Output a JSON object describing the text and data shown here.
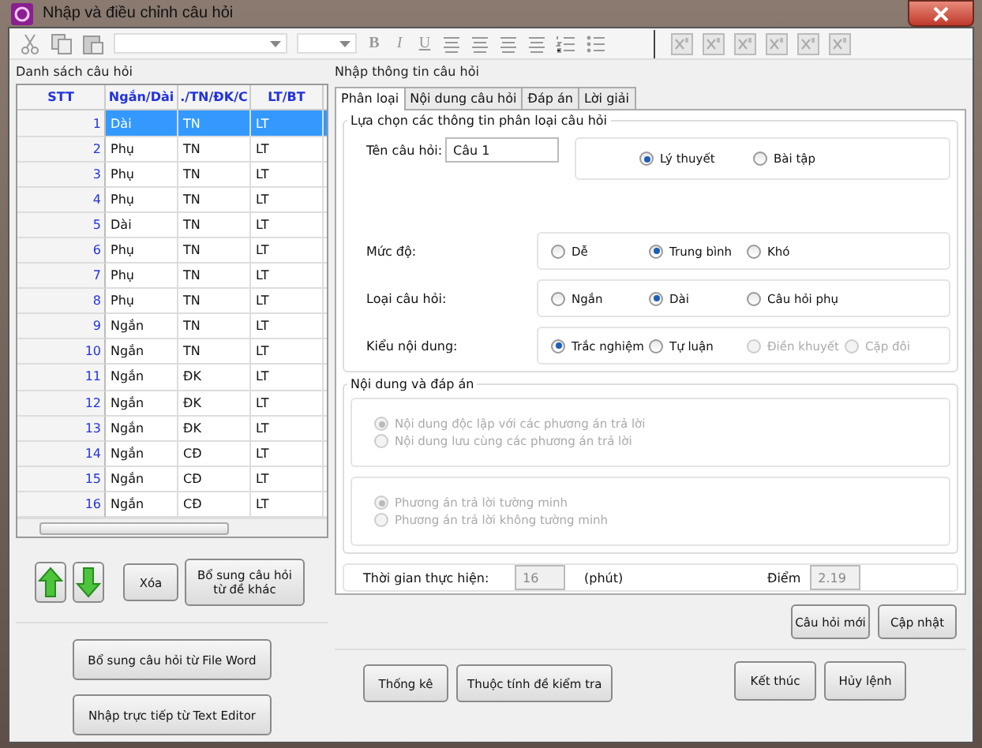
{
  "window": {
    "title": "Nhập và điều chỉnh câu hỏi"
  },
  "toolbar": {
    "format_buttons": [
      "B",
      "I",
      "U"
    ]
  },
  "question_list": {
    "title": "Danh sách câu hỏi",
    "columns": [
      "STT",
      "Ngắn/Dài",
      "./TN/ĐK/C",
      "LT/BT"
    ],
    "rows": [
      {
        "cells": [
          "1",
          "Dài",
          "TN",
          "LT"
        ],
        "selected": true
      },
      {
        "cells": [
          "2",
          "Phụ",
          "TN",
          "LT"
        ],
        "selected": false
      },
      {
        "cells": [
          "3",
          "Phụ",
          "TN",
          "LT"
        ],
        "selected": false
      },
      {
        "cells": [
          "4",
          "Phụ",
          "TN",
          "LT"
        ],
        "selected": false
      },
      {
        "cells": [
          "5",
          "Dài",
          "TN",
          "LT"
        ],
        "selected": false
      },
      {
        "cells": [
          "6",
          "Phụ",
          "TN",
          "LT"
        ],
        "selected": false
      },
      {
        "cells": [
          "7",
          "Phụ",
          "TN",
          "LT"
        ],
        "selected": false
      },
      {
        "cells": [
          "8",
          "Phụ",
          "TN",
          "LT"
        ],
        "selected": false
      },
      {
        "cells": [
          "9",
          "Ngắn",
          "TN",
          "LT"
        ],
        "selected": false
      },
      {
        "cells": [
          "10",
          "Ngắn",
          "TN",
          "LT"
        ],
        "selected": false
      },
      {
        "cells": [
          "11",
          "Ngắn",
          "ĐK",
          "LT"
        ],
        "selected": false
      },
      {
        "cells": [
          "12",
          "Ngắn",
          "ĐK",
          "LT"
        ],
        "selected": false
      },
      {
        "cells": [
          "13",
          "Ngắn",
          "ĐK",
          "LT"
        ],
        "selected": false
      },
      {
        "cells": [
          "14",
          "Ngắn",
          "CĐ",
          "LT"
        ],
        "selected": false
      },
      {
        "cells": [
          "15",
          "Ngắn",
          "CĐ",
          "LT"
        ],
        "selected": false
      },
      {
        "cells": [
          "16",
          "Ngắn",
          "CĐ",
          "LT"
        ],
        "selected": false
      }
    ],
    "buttons": [
      "Xóa",
      "Bổ sung câu hỏi từ  đề khác"
    ],
    "import_buttons": [
      "Bổ sung câu hỏi từ File Word",
      "Nhập trực tiếp từ Text Editor"
    ]
  },
  "editor": {
    "title": "Nhập thông tin câu hỏi",
    "tabs": [
      {
        "label": "Phân loại",
        "selected": true
      },
      {
        "label": "Nội dung câu hỏi",
        "selected": false
      },
      {
        "label": "Đáp án",
        "selected": false
      },
      {
        "label": "Lời giải",
        "selected": false
      }
    ],
    "classification": {
      "title": "Lựa chọn các thông tin phân loại câu hỏi",
      "name_label": "Tên câu hỏi:",
      "name_value": "Câu 1",
      "type_options": [
        {
          "label": "Lý thuyết",
          "selected": true,
          "disabled": false
        },
        {
          "label": "Bài tập",
          "selected": false,
          "disabled": false
        }
      ],
      "groups": [
        {
          "label": "Mức độ:",
          "options": [
            {
              "label": "Dễ",
              "selected": false,
              "disabled": false
            },
            {
              "label": "Trung bình",
              "selected": true,
              "disabled": false
            },
            {
              "label": "Khó",
              "selected": false,
              "disabled": false
            }
          ]
        },
        {
          "label": "Loại câu hỏi:",
          "options": [
            {
              "label": "Ngắn",
              "selected": false,
              "disabled": false
            },
            {
              "label": "Dài",
              "selected": true,
              "disabled": false
            },
            {
              "label": "Câu hỏi phụ",
              "selected": false,
              "disabled": false
            }
          ]
        },
        {
          "label": "Kiểu nội dung:",
          "options": [
            {
              "label": "Trắc nghiệm",
              "selected": true,
              "disabled": false
            },
            {
              "label": "Tự luận",
              "selected": false,
              "disabled": false
            },
            {
              "label": "Điền khuyết",
              "selected": false,
              "disabled": true
            },
            {
              "label": "Cặp đôi",
              "selected": false,
              "disabled": true
            }
          ]
        }
      ]
    },
    "content": {
      "title": "Nội dung và đáp án",
      "content_options": [
        {
          "label": "Nội dung độc lập với các phương án trả lời",
          "selected": true,
          "disabled": true
        },
        {
          "label": "Nội dung lưu cùng các phương án trả lời",
          "selected": false,
          "disabled": true
        }
      ],
      "answer_options": [
        {
          "label": "Phương án trả lời tường minh",
          "selected": true,
          "disabled": true
        },
        {
          "label": "Phương án trả lời không tường minh",
          "selected": false,
          "disabled": true
        }
      ]
    },
    "time_label": "Thời gian thực hiện:",
    "time_value": "16",
    "time_unit": "(phút)",
    "score_label": "Điểm",
    "score_value": "2.19",
    "actions": [
      "Câu hỏi mới",
      "Cập nhật"
    ]
  },
  "footer": {
    "left_buttons": [
      "Thống kê",
      "Thuộc tính đề kiểm tra"
    ],
    "right_buttons": [
      "Kết thúc",
      "Hủy lệnh"
    ]
  }
}
